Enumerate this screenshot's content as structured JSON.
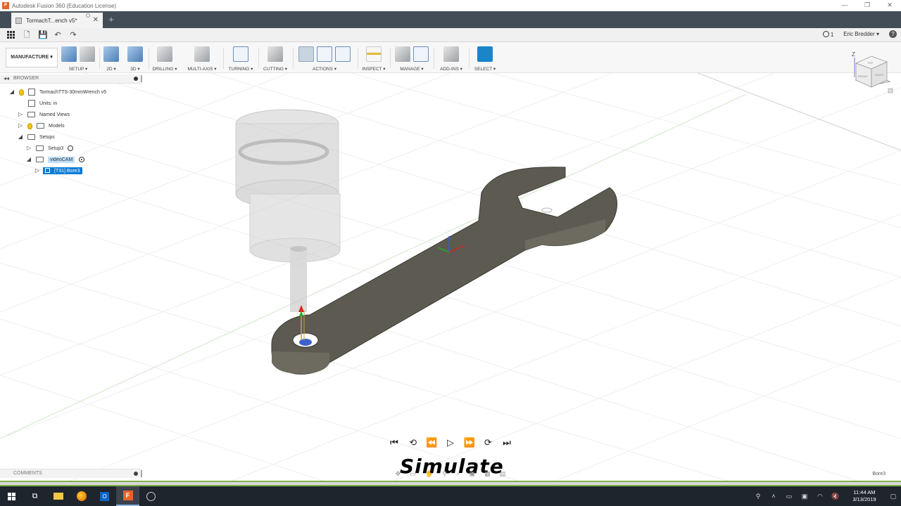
{
  "window": {
    "title": "Autodesk Fusion 360 (Education License)",
    "controls": [
      "—",
      "❐",
      "✕"
    ]
  },
  "tabs": [
    {
      "label": "TormachT...ench v5*",
      "close": "✕"
    }
  ],
  "new_tab": "+",
  "quick_access": {
    "jobs_count": "1",
    "user": "Eric Bredder ▾",
    "help": "?"
  },
  "ribbon": {
    "workspace": "MANUFACTURE ▾",
    "groups": {
      "setup": "SETUP ▾",
      "two_d": "2D ▾",
      "three_d": "3D ▾",
      "drilling": "DRILLING ▾",
      "multi_axis": "MULTI-AXIS ▾",
      "turning": "TURNING ▾",
      "cutting": "CUTTING ▾",
      "actions": "ACTIONS ▾",
      "inspect": "INSPECT ▾",
      "manage": "MANAGE ▾",
      "add_ins": "ADD-INS ▾",
      "select": "SELECT ▾"
    }
  },
  "browser": {
    "title": "BROWSER",
    "root": "TormachTTS-30mmWrench v5",
    "units": "Units: in",
    "named_views": "Named Views",
    "models": "Models",
    "setups": "Setups",
    "setup3": "Setup3",
    "videocam": "videoCAM",
    "bore": "[T31] Bore3"
  },
  "viewcube": {
    "axis_z": "Z",
    "face_top": "TOP",
    "face_front": "FRONT",
    "face_right": "RIGHT"
  },
  "simulate": {
    "title": "Simulate",
    "controls": [
      "⏮",
      "⟲",
      "⏪",
      "▷",
      "⏩",
      "⟳",
      "⏭"
    ]
  },
  "comments": {
    "title": "COMMENTS"
  },
  "status": {
    "operation": "Bore3"
  },
  "taskbar": {
    "time": "11:44 AM",
    "date": "3/13/2019"
  },
  "colors": {
    "titlebar_dark": "#434d57",
    "selection_blue": "#0a7bd6",
    "progress_green": "#7fb047",
    "part_color": "#5d5b51",
    "taskbar": "#1e252d"
  }
}
